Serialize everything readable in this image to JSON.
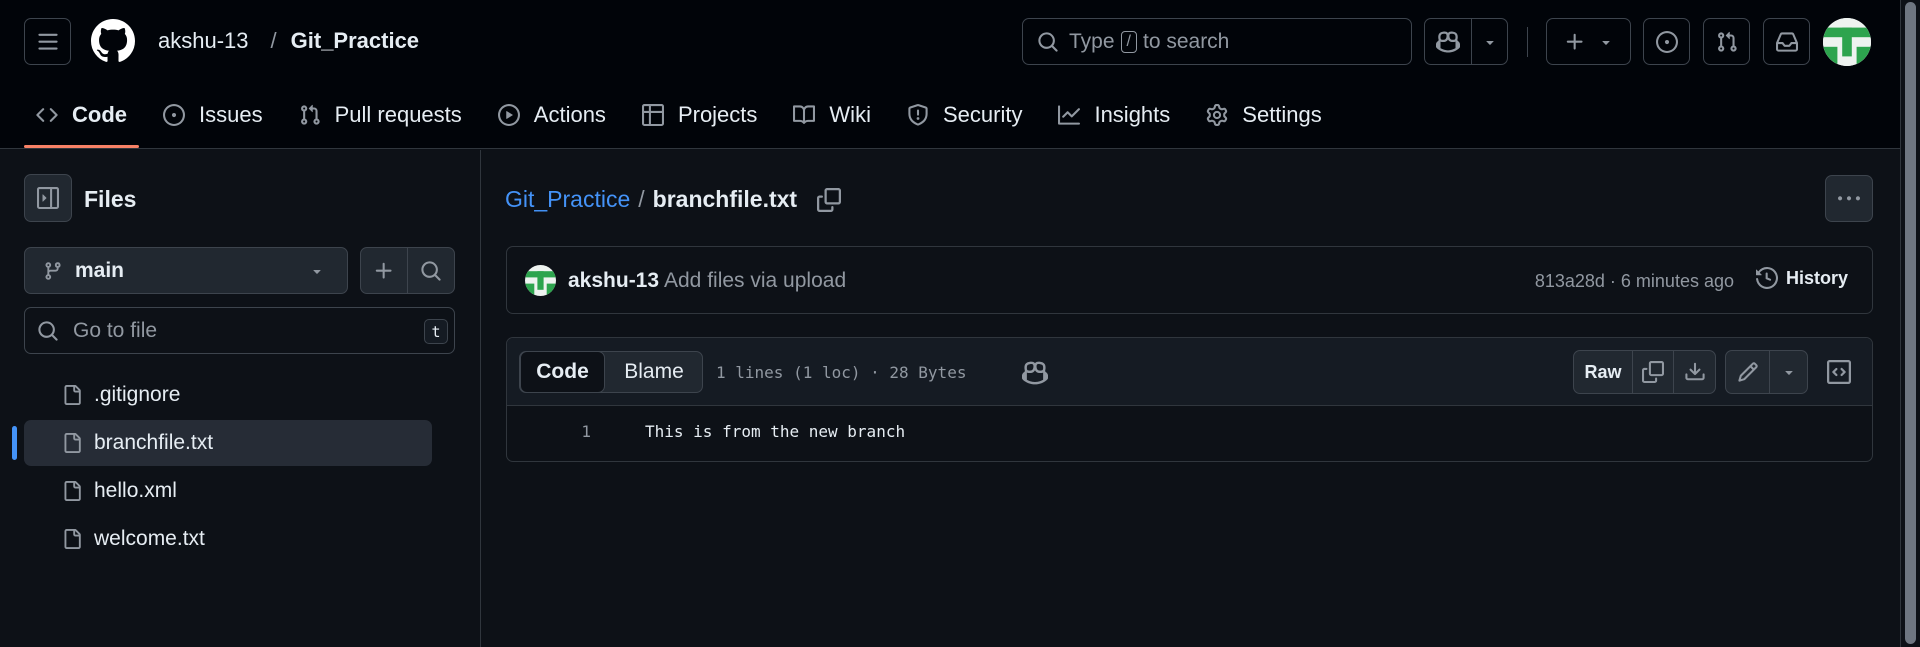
{
  "header": {
    "owner": "akshu-13",
    "separator": "/",
    "repo": "Git_Practice",
    "search": {
      "prefix": "Type",
      "key": "/",
      "suffix": "to search"
    }
  },
  "nav": {
    "items": [
      {
        "label": "Code",
        "icon": "code-icon",
        "active": true
      },
      {
        "label": "Issues",
        "icon": "issue-icon"
      },
      {
        "label": "Pull requests",
        "icon": "pull-request-icon"
      },
      {
        "label": "Actions",
        "icon": "play-icon"
      },
      {
        "label": "Projects",
        "icon": "table-icon"
      },
      {
        "label": "Wiki",
        "icon": "book-icon"
      },
      {
        "label": "Security",
        "icon": "shield-icon"
      },
      {
        "label": "Insights",
        "icon": "graph-icon"
      },
      {
        "label": "Settings",
        "icon": "gear-icon"
      }
    ]
  },
  "sidebar": {
    "title": "Files",
    "branch": "main",
    "goto_placeholder": "Go to file",
    "goto_key": "t",
    "files": [
      {
        "name": ".gitignore"
      },
      {
        "name": "branchfile.txt",
        "selected": true
      },
      {
        "name": "hello.xml"
      },
      {
        "name": "welcome.txt"
      }
    ]
  },
  "main": {
    "breadcrumb_repo": "Git_Practice",
    "breadcrumb_sep": "/",
    "file_name": "branchfile.txt",
    "commit": {
      "author": "akshu-13",
      "message": "Add files via upload",
      "sha_time": "813a28d · 6 minutes ago",
      "history_label": "History"
    },
    "file_toolbar": {
      "code_tab": "Code",
      "blame_tab": "Blame",
      "stats": "1 lines (1 loc) · 28 Bytes",
      "raw_label": "Raw"
    },
    "lines": [
      {
        "number": "1",
        "text": "This is from the new branch"
      }
    ]
  },
  "colors": {
    "accent_link": "#4493f8",
    "nav_underline": "#f78166",
    "avatar_green": "#2da44e"
  }
}
